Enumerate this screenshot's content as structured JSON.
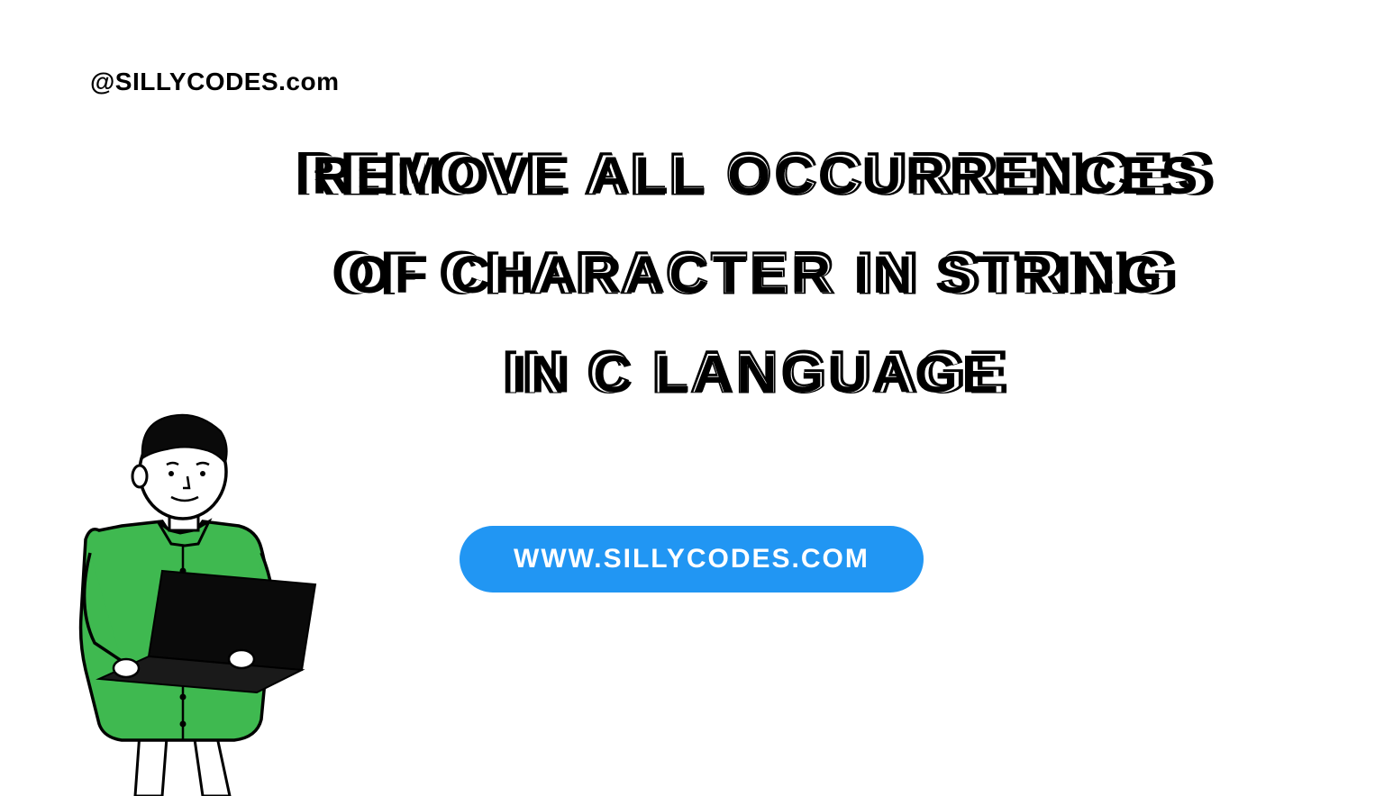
{
  "handle": "@SILLYCODES.com",
  "title": {
    "line1": "REMOVE ALL OCCURRENCES",
    "line2": "OF CHARACTER IN STRING",
    "line3": "IN C LANGUAGE"
  },
  "url": "WWW.SILLYCODES.COM",
  "colors": {
    "accent": "#2196F3",
    "shirt": "#3FB950",
    "text": "#000000",
    "background": "#ffffff"
  }
}
